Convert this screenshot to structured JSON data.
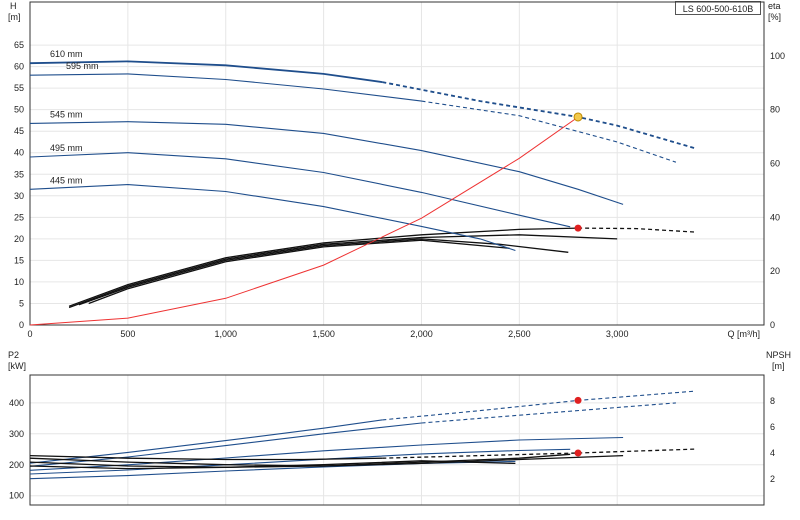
{
  "model_label": "LS 600-500-610B",
  "chart_data": [
    {
      "id": "head",
      "type": "line",
      "xlabel": "Q [m³/h]",
      "ylabel": "H",
      "ylabel_unit": "[m]",
      "y2label": "eta",
      "y2label_unit": "[%]",
      "xlim": [
        0,
        3750
      ],
      "ylim": [
        0,
        75
      ],
      "y2lim": [
        0,
        120
      ],
      "x_ticks": [
        0,
        500,
        1000,
        1500,
        2000,
        2500,
        3000
      ],
      "x_tick_labels": [
        "0",
        "500",
        "1,000",
        "1,500",
        "2,000",
        "2,500",
        "3,000"
      ],
      "y_ticks": [
        0,
        5,
        10,
        15,
        20,
        25,
        30,
        35,
        40,
        45,
        50,
        55,
        60,
        65
      ],
      "y2_ticks": [
        0,
        20,
        40,
        60,
        80,
        100
      ],
      "grid": true,
      "head_curves": [
        {
          "name": "610 mm",
          "color": "#1f4e8c",
          "width": 1.8,
          "solid": [
            [
              0,
              60.8
            ],
            [
              500,
              61.2
            ],
            [
              1000,
              60.3
            ],
            [
              1500,
              58.3
            ],
            [
              1800,
              56.4
            ]
          ],
          "dashed": [
            [
              1800,
              56.4
            ],
            [
              2300,
              52.0
            ],
            [
              2800,
              48.3
            ],
            [
              3000,
              46.3
            ],
            [
              3400,
              41.0
            ]
          ]
        },
        {
          "name": "595 mm",
          "color": "#1f4e8c",
          "width": 1.1,
          "solid": [
            [
              0,
              58.0
            ],
            [
              500,
              58.3
            ],
            [
              1000,
              57.0
            ],
            [
              1500,
              54.8
            ],
            [
              2000,
              52.0
            ]
          ],
          "dashed": [
            [
              2000,
              52.0
            ],
            [
              2500,
              48.6
            ],
            [
              3000,
              42.5
            ],
            [
              3300,
              37.8
            ]
          ]
        },
        {
          "name": "545 mm",
          "color": "#1f4e8c",
          "width": 1.1,
          "solid": [
            [
              0,
              46.8
            ],
            [
              500,
              47.2
            ],
            [
              1000,
              46.6
            ],
            [
              1500,
              44.5
            ],
            [
              2000,
              40.5
            ],
            [
              2500,
              35.6
            ],
            [
              2800,
              31.5
            ],
            [
              3030,
              28.0
            ]
          ],
          "dashed": []
        },
        {
          "name": "495 mm",
          "color": "#1f4e8c",
          "width": 1.1,
          "solid": [
            [
              0,
              39.0
            ],
            [
              500,
              40.0
            ],
            [
              1000,
              38.6
            ],
            [
              1500,
              35.4
            ],
            [
              2000,
              30.8
            ],
            [
              2500,
              25.5
            ],
            [
              2760,
              22.8
            ]
          ],
          "dashed": []
        },
        {
          "name": "445 mm",
          "color": "#1f4e8c",
          "width": 1.1,
          "solid": [
            [
              0,
              31.5
            ],
            [
              500,
              32.6
            ],
            [
              1000,
              31.0
            ],
            [
              1500,
              27.5
            ],
            [
              2000,
              22.9
            ],
            [
              2300,
              20.0
            ],
            [
              2480,
              17.3
            ]
          ],
          "dashed": []
        }
      ],
      "efficiency_curves": [
        {
          "solid": [
            [
              200,
              7.0
            ],
            [
              500,
              15.0
            ],
            [
              1000,
              25.0
            ],
            [
              1500,
              30.5
            ],
            [
              2000,
              33.5
            ],
            [
              2500,
              35.5
            ],
            [
              2800,
              36.0
            ]
          ],
          "dashed": [
            [
              2800,
              36.0
            ],
            [
              3100,
              35.8
            ],
            [
              3400,
              34.5
            ]
          ]
        },
        {
          "solid": [
            [
              200,
              6.5
            ],
            [
              500,
              14.5
            ],
            [
              1000,
              24.5
            ],
            [
              1500,
              30.0
            ],
            [
              2000,
              32.5
            ],
            [
              2500,
              33.5
            ],
            [
              3000,
              32.0
            ]
          ],
          "dashed": []
        },
        {
          "solid": [
            [
              250,
              7.5
            ],
            [
              500,
              14.0
            ],
            [
              1000,
              24.0
            ],
            [
              1500,
              29.5
            ],
            [
              2000,
              32.0
            ],
            [
              2400,
              30.0
            ],
            [
              2750,
              27.0
            ]
          ],
          "dashed": []
        },
        {
          "solid": [
            [
              300,
              8.0
            ],
            [
              500,
              13.5
            ],
            [
              1000,
              23.5
            ],
            [
              1500,
              29.0
            ],
            [
              2000,
              31.5
            ],
            [
              2450,
              28.5
            ]
          ],
          "dashed": []
        }
      ],
      "system_curve": {
        "color": "#ee3333",
        "points": [
          [
            0,
            0
          ],
          [
            500,
            1.6
          ],
          [
            1000,
            6.2
          ],
          [
            1500,
            13.9
          ],
          [
            2000,
            24.8
          ],
          [
            2500,
            38.7
          ],
          [
            2800,
            48.3
          ]
        ]
      },
      "duty_point": {
        "x": 2800,
        "y": 48.3,
        "color": "#f2c94c"
      },
      "eta_point": {
        "x": 2800,
        "y2": 36.0,
        "color": "#e02020"
      }
    },
    {
      "id": "power_npsh",
      "type": "line",
      "ylabel": "P2",
      "ylabel_unit": "[kW]",
      "y2label": "NPSH",
      "y2label_unit": "[m]",
      "xlim": [
        0,
        3750
      ],
      "ylim": [
        70,
        490
      ],
      "y2lim": [
        0,
        10
      ],
      "y_ticks": [
        100,
        200,
        300,
        400
      ],
      "y2_ticks": [
        2,
        4,
        6,
        8
      ],
      "grid": true,
      "power_curves": [
        {
          "solid": [
            [
              0,
              205
            ],
            [
              500,
              240
            ],
            [
              1000,
              278
            ],
            [
              1500,
              318
            ],
            [
              1800,
              345
            ]
          ],
          "dashed": [
            [
              1800,
              345
            ],
            [
              2300,
              375
            ],
            [
              2800,
              408
            ],
            [
              3400,
              438
            ]
          ]
        },
        {
          "solid": [
            [
              0,
              195
            ],
            [
              500,
              225
            ],
            [
              1000,
              262
            ],
            [
              1500,
              300
            ],
            [
              2000,
              335
            ]
          ],
          "dashed": [
            [
              2000,
              335
            ],
            [
              2500,
              360
            ],
            [
              3000,
              385
            ],
            [
              3300,
              400
            ]
          ]
        },
        {
          "solid": [
            [
              0,
              182
            ],
            [
              500,
              200
            ],
            [
              1000,
              222
            ],
            [
              1500,
              245
            ],
            [
              2000,
              264
            ],
            [
              2500,
              280
            ],
            [
              3030,
              288
            ]
          ],
          "dashed": []
        },
        {
          "solid": [
            [
              0,
              170
            ],
            [
              500,
              183
            ],
            [
              1000,
              200
            ],
            [
              1500,
              218
            ],
            [
              2000,
              235
            ],
            [
              2500,
              246
            ],
            [
              2760,
              250
            ]
          ],
          "dashed": []
        },
        {
          "solid": [
            [
              0,
              155
            ],
            [
              500,
              165
            ],
            [
              1000,
              180
            ],
            [
              1500,
              193
            ],
            [
              2000,
              204
            ],
            [
              2480,
              211
            ]
          ],
          "dashed": []
        }
      ],
      "npsh_curves": [
        {
          "solid": [
            [
              0,
              3.8
            ],
            [
              500,
              3.6
            ],
            [
              1000,
              3.5
            ],
            [
              1400,
              3.5
            ],
            [
              1800,
              3.6
            ]
          ],
          "dashed": [
            [
              1800,
              3.6
            ],
            [
              2300,
              3.8
            ],
            [
              2800,
              4.0
            ],
            [
              3400,
              4.3
            ]
          ]
        },
        {
          "solid": [
            [
              0,
              3.6
            ],
            [
              500,
              3.3
            ],
            [
              1000,
              3.1
            ],
            [
              1500,
              3.0
            ],
            [
              2000,
              3.2
            ],
            [
              2500,
              3.5
            ],
            [
              3030,
              3.8
            ]
          ],
          "dashed": []
        },
        {
          "solid": [
            [
              0,
              3.3
            ],
            [
              500,
              3.0
            ],
            [
              1000,
              2.9
            ],
            [
              1500,
              3.0
            ],
            [
              2000,
              3.3
            ],
            [
              2500,
              3.6
            ],
            [
              2760,
              3.9
            ]
          ],
          "dashed": []
        },
        {
          "solid": [
            [
              0,
              3.0
            ],
            [
              500,
              2.8
            ],
            [
              1000,
              2.9
            ],
            [
              1500,
              3.1
            ],
            [
              2000,
              3.4
            ],
            [
              2480,
              3.2
            ]
          ],
          "dashed": []
        }
      ],
      "power_point": {
        "x": 2800,
        "y": 408,
        "color": "#e02020"
      },
      "npsh_point": {
        "x": 2800,
        "y2": 4.0,
        "color": "#e02020"
      }
    }
  ]
}
